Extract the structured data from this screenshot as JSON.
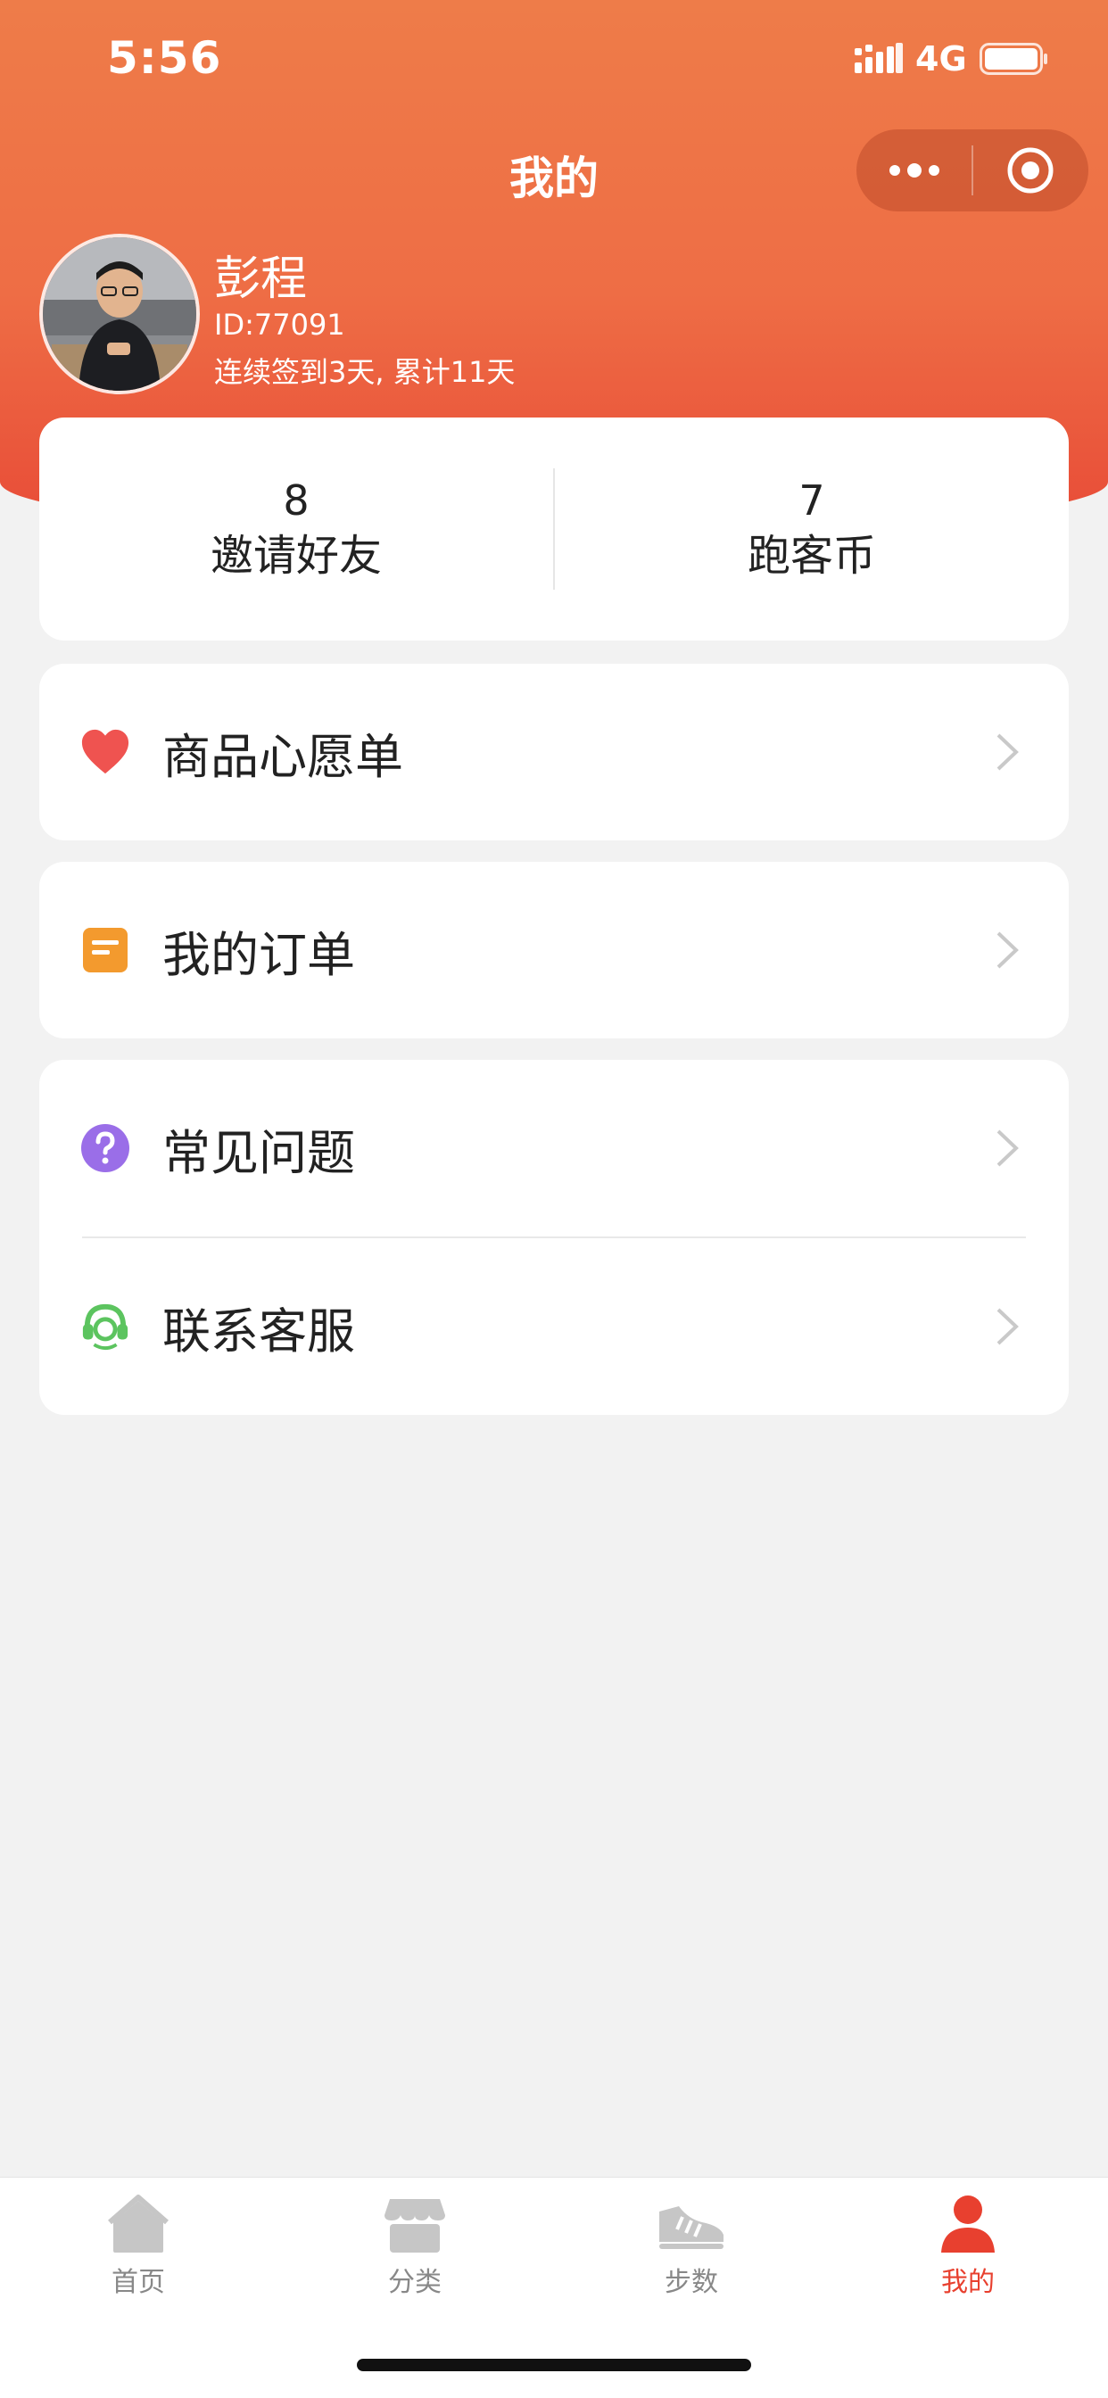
{
  "status_bar": {
    "time": "5:56",
    "network": "4G"
  },
  "nav": {
    "title": "我的"
  },
  "user": {
    "name": "彭程",
    "id_text": "ID:77091",
    "checkin_text": "连续签到3天, 累计11天"
  },
  "stats": [
    {
      "value": "8",
      "label": "邀请好友"
    },
    {
      "value": "7",
      "label": "跑客币"
    }
  ],
  "menu": {
    "wishlist": "商品心愿单",
    "orders": "我的订单",
    "faq": "常见问题",
    "support": "联系客服"
  },
  "tabbar": [
    {
      "label": "首页",
      "icon": "home-icon",
      "active": false
    },
    {
      "label": "分类",
      "icon": "category-icon",
      "active": false
    },
    {
      "label": "步数",
      "icon": "shoe-icon",
      "active": false
    },
    {
      "label": "我的",
      "icon": "profile-icon",
      "active": true
    }
  ],
  "colors": {
    "brand": "#ee6d45",
    "active_tab": "#e8402f",
    "heart": "#ef5350",
    "order_icon": "#f39a2e",
    "faq_icon": "#9a6ee8",
    "support_icon": "#5cc45f"
  }
}
